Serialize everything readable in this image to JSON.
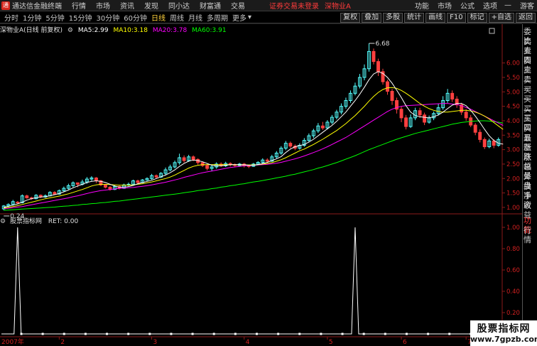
{
  "topbar": {
    "app_title": "通达信金融终端",
    "menu": [
      "行情",
      "市场",
      "资讯",
      "发现",
      "同小达",
      "财富通",
      "交易"
    ],
    "warning": "证券交易未登录",
    "stock_name": "深物业A",
    "right_menu": [
      "功能",
      "市场",
      "公式",
      "选项"
    ],
    "min_icon": "minimize-icon",
    "guest": "游客"
  },
  "periodbar": {
    "periods": [
      "分时",
      "1分钟",
      "5分钟",
      "15分钟",
      "30分钟",
      "60分钟",
      "日线",
      "周线",
      "月线",
      "多周期",
      "更多"
    ],
    "active_period": "日线",
    "tools": [
      "复权",
      "叠加",
      "多股",
      "统计",
      "画线",
      "F10",
      "标记",
      "+自选",
      "返回"
    ]
  },
  "main_info": {
    "title": "深物业A(日线 前复权)",
    "ma5_label": "MA5:",
    "ma5": "2.99",
    "ma10_label": "MA10:",
    "ma10": "3.18",
    "ma20_label": "MA20:",
    "ma20": "3.78",
    "ma60_label": "MA60:",
    "ma60": "3.91",
    "colors": {
      "ma5": "#ffffff",
      "ma10": "#ffff00",
      "ma20": "#ff00ff",
      "ma60": "#00ff00"
    }
  },
  "annotations": {
    "high": "6.68",
    "low": "0.24"
  },
  "price_axis": [
    "6.00",
    "5.50",
    "5.00",
    "4.50",
    "4.00",
    "3.50",
    "3.00",
    "2.50",
    "2.00",
    "1.50",
    "1.00"
  ],
  "sub_info": {
    "name": "股票指标网",
    "label": "RET:",
    "value": "0.00"
  },
  "sub_axis": [
    "1.00",
    "0.80",
    "0.60",
    "0.40",
    "0.20"
  ],
  "time_axis": {
    "start": "2007年",
    "labels": [
      "2",
      "3",
      "4",
      "5",
      "6",
      "7"
    ]
  },
  "sidepanel": [
    "委比",
    "卖五",
    "卖四",
    "卖三",
    "卖二",
    "卖一",
    "买一",
    "买二",
    "买三",
    "买四",
    "买五",
    "最新",
    "涨跌",
    "涨幅",
    "总量",
    "外盘",
    "换手",
    "净资",
    "收益",
    "",
    "",
    "",
    "",
    "",
    "",
    "",
    "",
    "",
    "",
    "",
    "",
    "",
    "",
    "",
    "",
    "",
    "",
    "",
    "",
    "",
    "",
    "",
    "",
    "",
    "",
    "",
    "",
    "",
    "",
    ""
  ],
  "sidepanel_tabs": [
    "功能",
    "行情"
  ],
  "watermark": {
    "line1": "股票指标网",
    "line2": "www.7gpzb.com"
  },
  "chart_data": {
    "type": "candlestick",
    "price_range": [
      0.85,
      7.0
    ],
    "up_color": "#54ffff",
    "down_color": "#ff4040",
    "candles": [
      [
        0.95,
        1.05,
        0.9,
        1.08
      ],
      [
        1.05,
        1.1,
        1.0,
        1.14
      ],
      [
        1.1,
        1.2,
        1.06,
        1.26
      ],
      [
        1.18,
        1.16,
        1.1,
        1.22
      ],
      [
        1.16,
        1.4,
        1.14,
        1.45
      ],
      [
        1.4,
        1.33,
        1.3,
        1.44
      ],
      [
        1.33,
        1.3,
        1.26,
        1.37
      ],
      [
        1.3,
        1.42,
        1.28,
        1.46
      ],
      [
        1.42,
        1.36,
        1.32,
        1.45
      ],
      [
        1.36,
        1.4,
        1.33,
        1.45
      ],
      [
        1.4,
        1.52,
        1.38,
        1.56
      ],
      [
        1.52,
        1.46,
        1.43,
        1.56
      ],
      [
        1.46,
        1.58,
        1.44,
        1.62
      ],
      [
        1.58,
        1.66,
        1.55,
        1.72
      ],
      [
        1.66,
        1.75,
        1.62,
        1.82
      ],
      [
        1.75,
        1.85,
        1.7,
        1.9
      ],
      [
        1.85,
        1.8,
        1.7,
        1.86
      ],
      [
        1.8,
        1.88,
        1.76,
        1.96
      ],
      [
        1.88,
        1.98,
        1.82,
        2.05
      ],
      [
        1.98,
        2.02,
        1.92,
        2.08
      ],
      [
        2.02,
        1.92,
        1.84,
        2.05
      ],
      [
        1.92,
        1.78,
        1.74,
        1.95
      ],
      [
        1.78,
        1.7,
        1.66,
        1.8
      ],
      [
        1.7,
        1.62,
        1.58,
        1.74
      ],
      [
        1.62,
        1.72,
        1.6,
        1.76
      ],
      [
        1.72,
        1.66,
        1.62,
        1.76
      ],
      [
        1.66,
        1.78,
        1.64,
        1.82
      ],
      [
        1.78,
        1.8,
        1.74,
        1.86
      ],
      [
        1.8,
        1.92,
        1.78,
        1.96
      ],
      [
        1.92,
        1.86,
        1.82,
        1.96
      ],
      [
        1.86,
        1.95,
        1.84,
        1.98
      ],
      [
        1.95,
        2.0,
        1.92,
        2.04
      ],
      [
        2.0,
        2.1,
        1.96,
        2.16
      ],
      [
        2.1,
        2.05,
        2.0,
        2.14
      ],
      [
        2.05,
        2.18,
        2.02,
        2.22
      ],
      [
        2.18,
        2.3,
        2.12,
        2.38
      ],
      [
        2.3,
        2.4,
        2.25,
        2.48
      ],
      [
        2.4,
        2.55,
        2.35,
        2.62
      ],
      [
        2.55,
        2.72,
        2.48,
        2.86
      ],
      [
        2.72,
        2.62,
        2.55,
        2.8
      ],
      [
        2.62,
        2.75,
        2.58,
        2.82
      ],
      [
        2.75,
        2.66,
        2.6,
        2.8
      ],
      [
        2.66,
        2.55,
        2.48,
        2.7
      ],
      [
        2.55,
        2.45,
        2.4,
        2.58
      ],
      [
        2.45,
        2.35,
        2.28,
        2.5
      ],
      [
        2.35,
        2.4,
        2.25,
        2.46
      ],
      [
        2.4,
        2.5,
        2.34,
        2.56
      ],
      [
        2.5,
        2.44,
        2.4,
        2.56
      ],
      [
        2.44,
        2.52,
        2.4,
        2.58
      ],
      [
        2.52,
        2.48,
        2.42,
        2.56
      ],
      [
        2.48,
        2.45,
        2.4,
        2.52
      ],
      [
        2.45,
        2.5,
        2.42,
        2.54
      ],
      [
        2.5,
        2.44,
        2.38,
        2.54
      ],
      [
        2.44,
        2.42,
        2.36,
        2.48
      ],
      [
        2.42,
        2.5,
        2.4,
        2.54
      ],
      [
        2.5,
        2.56,
        2.46,
        2.6
      ],
      [
        2.56,
        2.64,
        2.52,
        2.7
      ],
      [
        2.64,
        2.6,
        2.54,
        2.7
      ],
      [
        2.6,
        2.75,
        2.58,
        2.82
      ],
      [
        2.75,
        2.88,
        2.7,
        2.95
      ],
      [
        2.88,
        3.05,
        2.82,
        3.12
      ],
      [
        3.05,
        3.22,
        2.98,
        3.3
      ],
      [
        3.22,
        3.12,
        3.05,
        3.28
      ],
      [
        3.12,
        3.05,
        2.98,
        3.18
      ],
      [
        3.05,
        3.15,
        3.0,
        3.22
      ],
      [
        3.15,
        3.32,
        3.1,
        3.4
      ],
      [
        3.32,
        3.48,
        3.25,
        3.56
      ],
      [
        3.48,
        3.65,
        3.4,
        3.72
      ],
      [
        3.65,
        3.82,
        3.58,
        3.92
      ],
      [
        3.82,
        3.75,
        3.68,
        3.96
      ],
      [
        3.75,
        3.95,
        3.7,
        4.02
      ],
      [
        3.95,
        4.12,
        3.88,
        4.2
      ],
      [
        4.12,
        4.3,
        4.05,
        4.38
      ],
      [
        4.3,
        4.5,
        4.22,
        4.6
      ],
      [
        4.5,
        4.7,
        4.42,
        4.8
      ],
      [
        4.7,
        4.95,
        4.62,
        5.05
      ],
      [
        4.95,
        5.2,
        4.88,
        5.32
      ],
      [
        5.2,
        5.5,
        5.12,
        5.62
      ],
      [
        5.5,
        5.8,
        5.4,
        5.95
      ],
      [
        5.8,
        6.4,
        5.7,
        6.68
      ],
      [
        6.4,
        6.05,
        5.95,
        6.5
      ],
      [
        6.05,
        5.7,
        5.55,
        6.15
      ],
      [
        5.7,
        5.35,
        5.25,
        5.8
      ],
      [
        5.35,
        5.02,
        4.9,
        5.42
      ],
      [
        5.02,
        4.7,
        4.55,
        5.1
      ],
      [
        4.7,
        4.4,
        4.25,
        4.8
      ],
      [
        4.4,
        4.1,
        3.95,
        4.5
      ],
      [
        4.1,
        3.8,
        3.7,
        4.2
      ],
      [
        3.8,
        4.1,
        3.75,
        4.22
      ],
      [
        4.1,
        4.35,
        4.02,
        4.45
      ],
      [
        4.35,
        4.2,
        4.1,
        4.45
      ],
      [
        4.2,
        3.95,
        3.85,
        4.28
      ],
      [
        3.95,
        4.1,
        3.9,
        4.18
      ],
      [
        4.1,
        4.25,
        4.02,
        4.32
      ],
      [
        4.25,
        4.45,
        4.18,
        4.58
      ],
      [
        4.45,
        4.7,
        4.38,
        4.85
      ],
      [
        4.7,
        4.95,
        4.62,
        5.1
      ],
      [
        4.95,
        4.75,
        4.65,
        5.05
      ],
      [
        4.75,
        4.55,
        4.45,
        4.85
      ],
      [
        4.55,
        4.3,
        4.2,
        4.62
      ],
      [
        4.3,
        4.1,
        4.0,
        4.4
      ],
      [
        4.1,
        3.85,
        3.78,
        4.2
      ],
      [
        3.85,
        3.6,
        3.5,
        3.92
      ],
      [
        3.6,
        3.35,
        3.25,
        3.7
      ],
      [
        3.35,
        3.1,
        3.02,
        3.42
      ],
      [
        3.1,
        3.3,
        3.05,
        3.38
      ],
      [
        3.3,
        3.15,
        3.05,
        3.36
      ],
      [
        3.15,
        3.35,
        3.1,
        3.42
      ]
    ],
    "ma5": [
      1.0,
      1.04,
      1.08,
      1.12,
      1.18,
      1.25,
      1.3,
      1.34,
      1.36,
      1.37,
      1.4,
      1.44,
      1.48,
      1.54,
      1.6,
      1.68,
      1.74,
      1.8,
      1.86,
      1.9,
      1.92,
      1.9,
      1.86,
      1.8,
      1.74,
      1.7,
      1.7,
      1.72,
      1.76,
      1.82,
      1.86,
      1.9,
      1.94,
      2.0,
      2.06,
      2.12,
      2.2,
      2.3,
      2.42,
      2.52,
      2.6,
      2.64,
      2.62,
      2.58,
      2.52,
      2.46,
      2.44,
      2.44,
      2.46,
      2.48,
      2.48,
      2.48,
      2.48,
      2.46,
      2.46,
      2.48,
      2.52,
      2.56,
      2.62,
      2.68,
      2.76,
      2.9,
      3.02,
      3.1,
      3.14,
      3.18,
      3.26,
      3.36,
      3.48,
      3.6,
      3.72,
      3.84,
      3.98,
      4.14,
      4.3,
      4.5,
      4.7,
      4.92,
      5.16,
      5.42,
      5.62,
      5.7,
      5.64,
      5.5,
      5.3,
      5.06,
      4.8,
      4.52,
      4.3,
      4.18,
      4.14,
      4.12,
      4.1,
      4.14,
      4.2,
      4.3,
      4.42,
      4.54,
      4.6,
      4.6,
      4.52,
      4.36,
      4.16,
      3.94,
      3.7,
      3.48,
      3.32,
      3.22,
      3.19
    ],
    "ma10": [
      0.98,
      1.0,
      1.03,
      1.06,
      1.1,
      1.14,
      1.18,
      1.22,
      1.26,
      1.3,
      1.33,
      1.36,
      1.39,
      1.43,
      1.47,
      1.52,
      1.57,
      1.62,
      1.68,
      1.74,
      1.78,
      1.8,
      1.8,
      1.79,
      1.78,
      1.77,
      1.77,
      1.77,
      1.78,
      1.8,
      1.82,
      1.85,
      1.88,
      1.92,
      1.96,
      2.0,
      2.05,
      2.12,
      2.2,
      2.28,
      2.36,
      2.42,
      2.46,
      2.48,
      2.48,
      2.48,
      2.48,
      2.48,
      2.48,
      2.48,
      2.48,
      2.47,
      2.47,
      2.47,
      2.47,
      2.48,
      2.5,
      2.52,
      2.55,
      2.6,
      2.65,
      2.72,
      2.8,
      2.88,
      2.96,
      3.02,
      3.1,
      3.18,
      3.27,
      3.36,
      3.46,
      3.56,
      3.66,
      3.78,
      3.9,
      4.04,
      4.18,
      4.34,
      4.5,
      4.68,
      4.84,
      4.98,
      5.08,
      5.14,
      5.15,
      5.12,
      5.05,
      4.95,
      4.84,
      4.72,
      4.6,
      4.5,
      4.42,
      4.36,
      4.32,
      4.3,
      4.3,
      4.32,
      4.34,
      4.36,
      4.36,
      4.34,
      4.3,
      4.24,
      4.16,
      4.06,
      3.94,
      3.82,
      3.7
    ],
    "ma20": [
      0.96,
      0.97,
      0.99,
      1.01,
      1.03,
      1.06,
      1.09,
      1.12,
      1.15,
      1.18,
      1.21,
      1.24,
      1.27,
      1.3,
      1.33,
      1.37,
      1.4,
      1.44,
      1.48,
      1.52,
      1.55,
      1.58,
      1.6,
      1.62,
      1.64,
      1.66,
      1.67,
      1.68,
      1.69,
      1.71,
      1.73,
      1.75,
      1.78,
      1.81,
      1.84,
      1.87,
      1.91,
      1.95,
      1.99,
      2.04,
      2.08,
      2.12,
      2.16,
      2.2,
      2.23,
      2.26,
      2.29,
      2.32,
      2.35,
      2.38,
      2.4,
      2.42,
      2.44,
      2.45,
      2.46,
      2.47,
      2.48,
      2.49,
      2.51,
      2.53,
      2.56,
      2.6,
      2.64,
      2.68,
      2.73,
      2.78,
      2.84,
      2.9,
      2.96,
      3.03,
      3.1,
      3.18,
      3.26,
      3.34,
      3.42,
      3.52,
      3.62,
      3.72,
      3.82,
      3.92,
      4.02,
      4.12,
      4.22,
      4.32,
      4.4,
      4.46,
      4.5,
      4.52,
      4.53,
      4.54,
      4.55,
      4.56,
      4.57,
      4.58,
      4.59,
      4.6,
      4.6,
      4.58,
      4.56,
      4.52,
      4.46,
      4.4,
      4.32,
      4.24,
      4.16,
      4.08,
      4.0,
      3.92,
      3.84
    ],
    "ma60": [
      0.9,
      0.91,
      0.92,
      0.93,
      0.94,
      0.95,
      0.96,
      0.97,
      0.98,
      0.99,
      1.0,
      1.01,
      1.03,
      1.04,
      1.05,
      1.07,
      1.08,
      1.1,
      1.11,
      1.13,
      1.14,
      1.16,
      1.17,
      1.19,
      1.21,
      1.22,
      1.24,
      1.26,
      1.28,
      1.3,
      1.32,
      1.34,
      1.36,
      1.38,
      1.4,
      1.42,
      1.44,
      1.46,
      1.48,
      1.51,
      1.53,
      1.55,
      1.58,
      1.6,
      1.62,
      1.65,
      1.67,
      1.7,
      1.72,
      1.75,
      1.77,
      1.8,
      1.82,
      1.85,
      1.88,
      1.9,
      1.93,
      1.96,
      1.99,
      2.02,
      2.05,
      2.08,
      2.12,
      2.15,
      2.19,
      2.23,
      2.27,
      2.31,
      2.36,
      2.4,
      2.45,
      2.5,
      2.55,
      2.61,
      2.67,
      2.73,
      2.79,
      2.86,
      2.93,
      3.0,
      3.06,
      3.12,
      3.18,
      3.24,
      3.3,
      3.36,
      3.41,
      3.46,
      3.51,
      3.56,
      3.6,
      3.64,
      3.68,
      3.72,
      3.76,
      3.8,
      3.84,
      3.88,
      3.91,
      3.94,
      3.96,
      3.98,
      3.99,
      4.0,
      4.0,
      3.99,
      3.97,
      3.95,
      3.92
    ],
    "indicator": {
      "name": "RET",
      "range": [
        0,
        1.0
      ],
      "spikes": [
        {
          "index": 3,
          "value": 1.0
        },
        {
          "index": 76,
          "value": 1.0
        }
      ],
      "marker_count": 23
    }
  }
}
